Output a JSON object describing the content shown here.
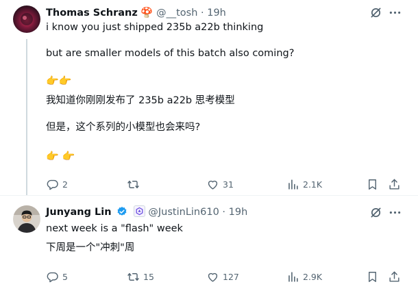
{
  "tweet1": {
    "name": "Thomas Schranz",
    "name_emoji": "🍄",
    "handle": "@__tosh",
    "dot": "·",
    "time": "19h",
    "lines": [
      "i know you just shipped 235b a22b thinking",
      "but are smaller models of this batch also coming?",
      "👉👉",
      "我知道你刚刚发布了 235b a22b 思考模型",
      "但是，这个系列的小模型也会来吗?",
      "👉 👉"
    ],
    "actions": {
      "replies": "2",
      "reposts": "",
      "likes": "31",
      "views": "2.1K"
    }
  },
  "tweet2": {
    "name": "Junyang Lin",
    "handle": "@JustinLin610",
    "dot": "·",
    "time": "19h",
    "lines": [
      "next week is a \"flash\" week",
      "下周是一个\"冲刺\"周"
    ],
    "actions": {
      "replies": "5",
      "reposts": "15",
      "likes": "127",
      "views": "2.9K"
    }
  },
  "icons": {
    "grok": "grok-icon",
    "more": "more-options-icon",
    "reply": "reply-icon",
    "repost": "repost-icon",
    "like": "like-icon",
    "views": "views-icon",
    "bookmark": "bookmark-icon",
    "share": "share-icon",
    "verified": "verified-badge-icon"
  },
  "colors": {
    "text": "#0f1419",
    "secondary": "#536471",
    "verified": "#1d9bf0",
    "divider": "#eff3f4",
    "thread_line": "#cfd9de"
  }
}
